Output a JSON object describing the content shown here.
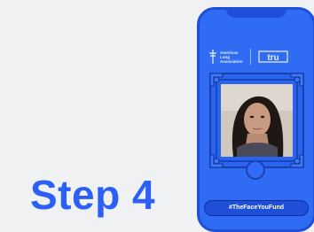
{
  "step": {
    "title": "Step 4"
  },
  "header": {
    "ala_logo_text": "American Lung Association",
    "tru_logo_text": "tru"
  },
  "campaign": {
    "hashtag_button_label": "#TheFaceYouFund"
  },
  "colors": {
    "brand_blue": "#2c5ff6",
    "phone_blue": "#2f6cf3",
    "phone_border": "#1f4fd8",
    "background": "#f0f1f3"
  },
  "icons": [
    "american-lung-association-logo",
    "truth-logo",
    "camera-shutter-icon"
  ]
}
